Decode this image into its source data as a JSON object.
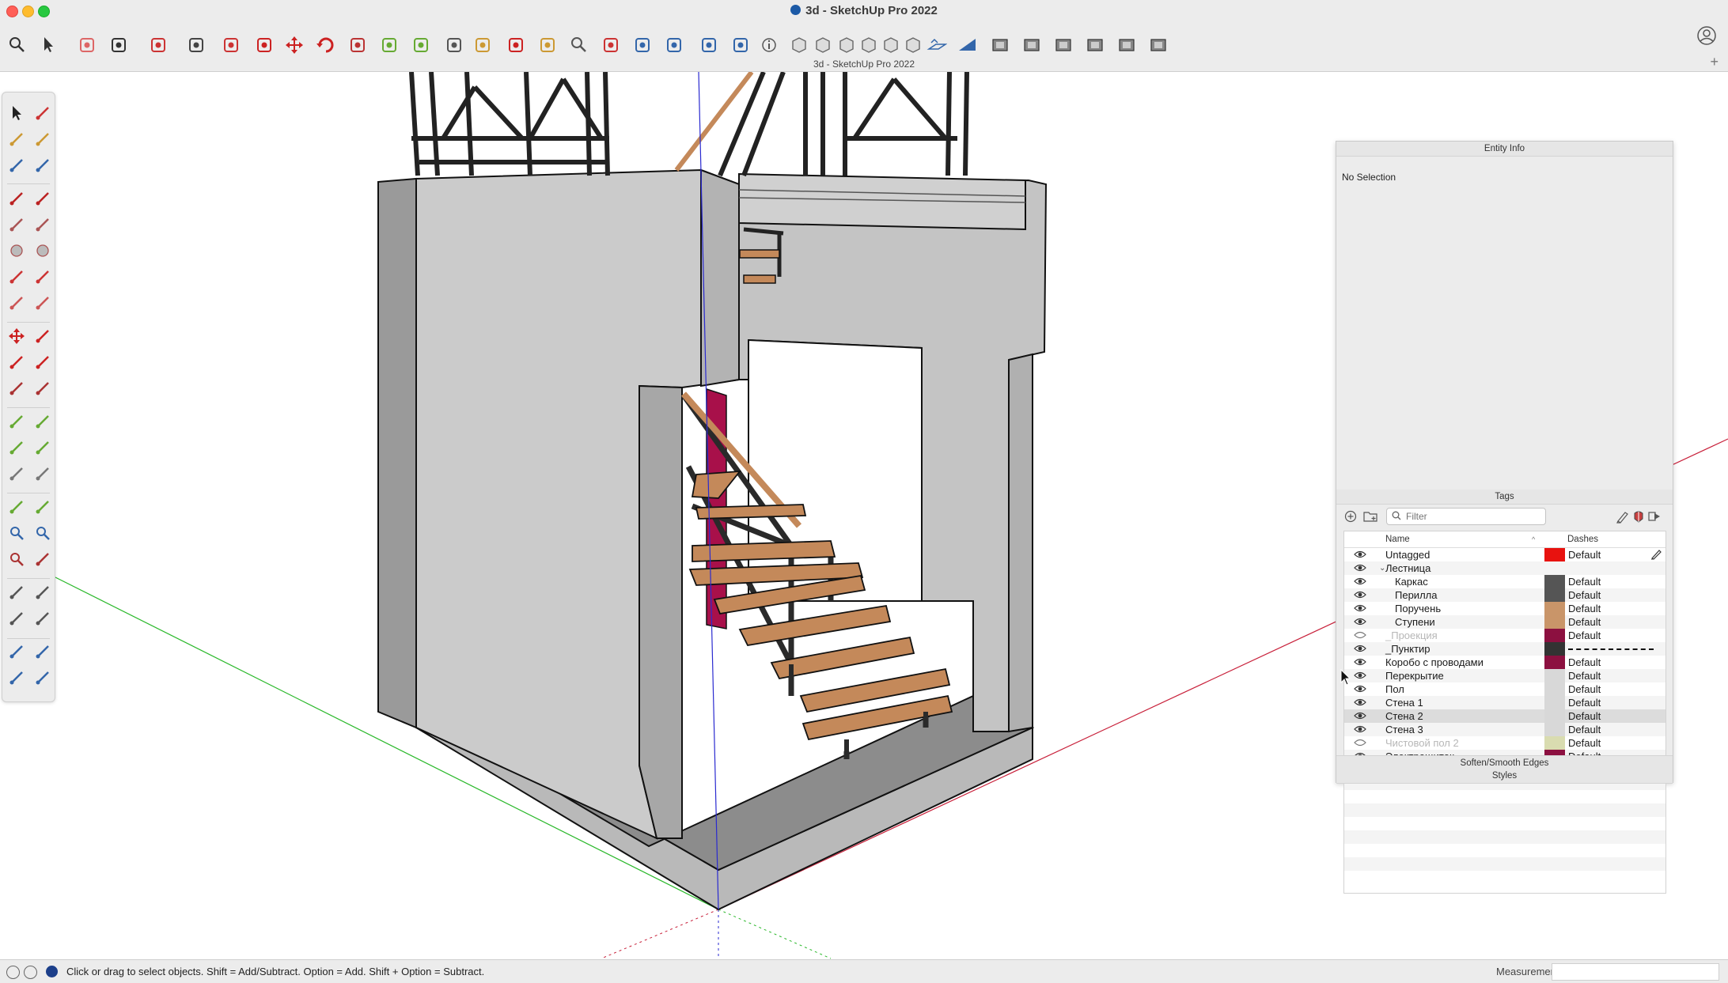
{
  "window": {
    "title": "3d - SketchUp Pro 2022",
    "document_label": "3d - SketchUp Pro 2022"
  },
  "toolbar": {
    "icons": [
      "search-icon",
      "select-icon",
      "eraser-icon",
      "line-icon",
      "arc-icon",
      "shape-icon",
      "push-pull-icon",
      "offset-icon",
      "move-icon",
      "rotate-icon",
      "scale-icon",
      "tape-measure-icon",
      "protractor-icon",
      "text-icon",
      "paint-bucket-icon",
      "orbit-icon",
      "pan-icon",
      "zoom-icon",
      "zoom-extents-icon",
      "warehouse-icon",
      "extension-icon",
      "layers-icon",
      "components-icon",
      "info-icon",
      "xray-style-icon",
      "wireframe-style-icon",
      "hidden-line-style-icon",
      "shaded-style-icon",
      "textured-style-icon",
      "monochrome-style-icon",
      "section-plane-icon",
      "sandbox-icon",
      "view-iso-icon",
      "view-top-icon",
      "view-front-icon",
      "view-right-icon",
      "view-back-icon",
      "view-left-icon"
    ]
  },
  "entity_info": {
    "title": "Entity Info",
    "status": "No Selection"
  },
  "tags": {
    "title": "Tags",
    "filter_placeholder": "Filter",
    "columns": {
      "name": "Name",
      "dashes": "Dashes"
    },
    "rows": [
      {
        "name": "Untagged",
        "color": "#e8120f",
        "dashes": "Default",
        "visible": true,
        "indent": 0,
        "active": true
      },
      {
        "name": "Лестница",
        "color": "",
        "dashes": "",
        "visible": true,
        "indent": 0,
        "folder": true
      },
      {
        "name": "Каркас",
        "color": "#555555",
        "dashes": "Default",
        "visible": true,
        "indent": 1
      },
      {
        "name": "Перилла",
        "color": "#555555",
        "dashes": "Default",
        "visible": true,
        "indent": 1
      },
      {
        "name": "Поручень",
        "color": "#c99569",
        "dashes": "Default",
        "visible": true,
        "indent": 1
      },
      {
        "name": "Ступени",
        "color": "#c99569",
        "dashes": "Default",
        "visible": true,
        "indent": 1
      },
      {
        "name": "_Проекция",
        "color": "#8c1040",
        "dashes": "Default",
        "visible": false,
        "indent": 0
      },
      {
        "name": "_Пунктир",
        "color": "#333333",
        "dashes": "dashed",
        "visible": true,
        "indent": 0
      },
      {
        "name": "Коробо с проводами",
        "color": "#8c1040",
        "dashes": "Default",
        "visible": true,
        "indent": 0
      },
      {
        "name": "Перекрытие",
        "color": "#d8d8d8",
        "dashes": "Default",
        "visible": true,
        "indent": 0
      },
      {
        "name": "Пол",
        "color": "#d8d8d8",
        "dashes": "Default",
        "visible": true,
        "indent": 0
      },
      {
        "name": "Стена 1",
        "color": "#d8d8d8",
        "dashes": "Default",
        "visible": true,
        "indent": 0
      },
      {
        "name": "Стена 2",
        "color": "#d8d8d8",
        "dashes": "Default",
        "visible": true,
        "indent": 0,
        "selected": true
      },
      {
        "name": "Стена 3",
        "color": "#d8d8d8",
        "dashes": "Default",
        "visible": true,
        "indent": 0
      },
      {
        "name": "Чистовой пол 2",
        "color": "#d9dcb0",
        "dashes": "Default",
        "visible": false,
        "indent": 0
      },
      {
        "name": "Электрощиток",
        "color": "#8c1040",
        "dashes": "Default",
        "visible": true,
        "indent": 0
      }
    ]
  },
  "trays": {
    "soften": "Soften/Smooth Edges",
    "styles": "Styles"
  },
  "status_bar": {
    "hint": "Click or drag to select objects. Shift = Add/Subtract. Option = Add. Shift + Option = Subtract.",
    "measurements_label": "Measurements",
    "measurements_value": ""
  },
  "colors": {
    "axis_red": "#c8203a",
    "axis_green": "#2ab82a",
    "axis_blue": "#2a2ad0",
    "wall": "#c9c9c9",
    "wood": "#c4895a",
    "steel": "#3a3a3a"
  }
}
